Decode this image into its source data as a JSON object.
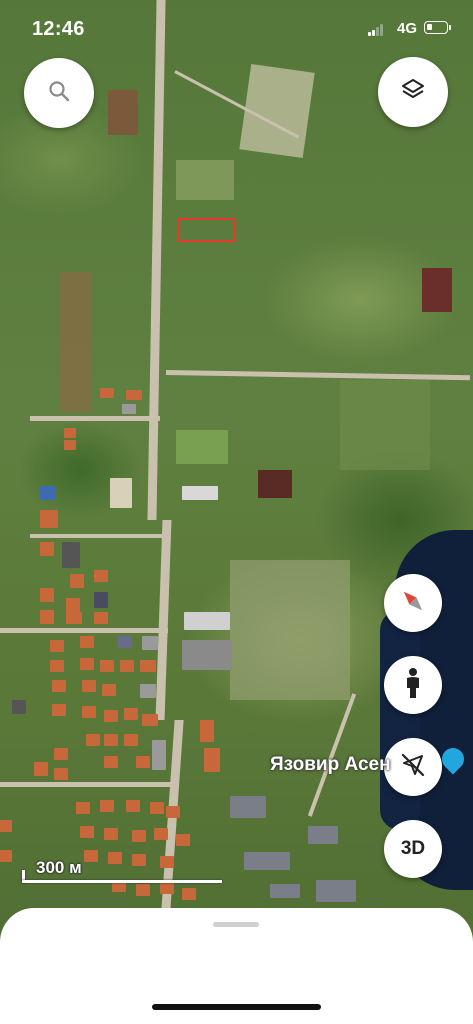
{
  "status_bar": {
    "time": "12:46",
    "network": "4G"
  },
  "map": {
    "place_label": "Язовир Асен",
    "scale_label": "300 м",
    "place_pin_color": "#21a6e0",
    "selection_color": "#e53a2c"
  },
  "controls": {
    "search_icon": "search-icon",
    "layers_icon": "layers-icon",
    "compass_icon": "compass-icon",
    "pegman_icon": "street-view-icon",
    "location_icon": "location-off-icon",
    "three_d_label": "3D"
  }
}
